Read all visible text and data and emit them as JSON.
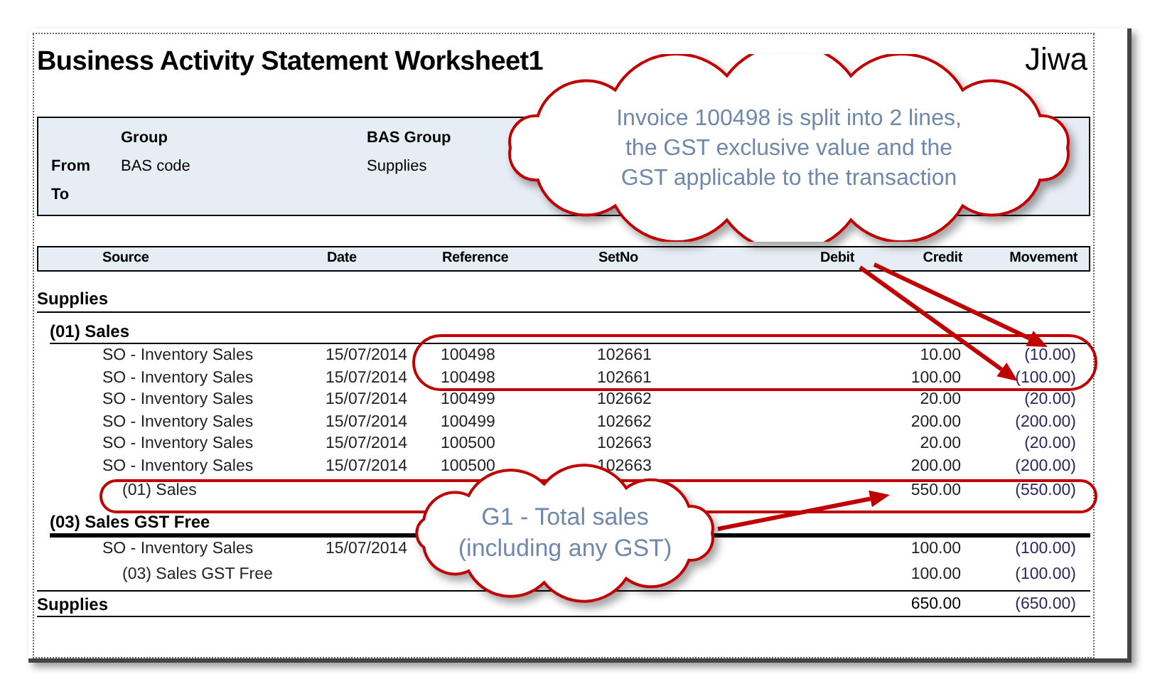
{
  "report": {
    "title": "Business Activity Statement Worksheet1",
    "logo": "Jiwa",
    "filter": {
      "columns": [
        "Group",
        "BAS Group"
      ],
      "rows": [
        {
          "label": "From",
          "values": [
            "BAS code",
            "Supplies"
          ]
        },
        {
          "label": "To"
        }
      ]
    },
    "table": {
      "columns": [
        "Source",
        "Date",
        "Reference",
        "SetNo",
        "Debit",
        "Credit",
        "Movement"
      ],
      "sections": [
        {
          "title": "Supplies",
          "groups": [
            {
              "title": "(01) Sales",
              "rows": [
                {
                  "source": "SO - Inventory Sales",
                  "date": "15/07/2014",
                  "reference": "100498",
                  "setno": "102661",
                  "credit": "10.00",
                  "movement": "(10.00)"
                },
                {
                  "source": "SO - Inventory Sales",
                  "date": "15/07/2014",
                  "reference": "100498",
                  "setno": "102661",
                  "credit": "100.00",
                  "movement": "(100.00)"
                },
                {
                  "source": "SO - Inventory Sales",
                  "date": "15/07/2014",
                  "reference": "100499",
                  "setno": "102662",
                  "credit": "20.00",
                  "movement": "(20.00)"
                },
                {
                  "source": "SO - Inventory Sales",
                  "date": "15/07/2014",
                  "reference": "100499",
                  "setno": "102662",
                  "credit": "200.00",
                  "movement": "(200.00)"
                },
                {
                  "source": "SO - Inventory Sales",
                  "date": "15/07/2014",
                  "reference": "100500",
                  "setno": "102663",
                  "credit": "20.00",
                  "movement": "(20.00)"
                },
                {
                  "source": "SO - Inventory Sales",
                  "date": "15/07/2014",
                  "reference": "100500",
                  "setno": "102663",
                  "credit": "200.00",
                  "movement": "(200.00)"
                }
              ],
              "subtotal": {
                "label": "(01) Sales",
                "credit": "550.00",
                "movement": "(550.00)"
              }
            },
            {
              "title": "(03) Sales GST Free",
              "rows": [
                {
                  "source": "SO - Inventory Sales",
                  "date": "15/07/2014",
                  "credit": "100.00",
                  "movement": "(100.00)"
                }
              ],
              "subtotal": {
                "label": "(03) Sales GST Free",
                "credit": "100.00",
                "movement": "(100.00)"
              }
            }
          ],
          "total": {
            "label": "Supplies",
            "credit": "650.00",
            "movement": "(650.00)"
          }
        }
      ]
    }
  },
  "callouts": [
    {
      "kind": "cloud",
      "lines": [
        "Invoice 100498 is split into 2 lines,",
        "the GST exclusive value and the",
        "GST applicable to the transaction"
      ]
    },
    {
      "kind": "cloud",
      "lines": [
        "G1 - Total sales",
        "(including any GST)"
      ]
    }
  ]
}
